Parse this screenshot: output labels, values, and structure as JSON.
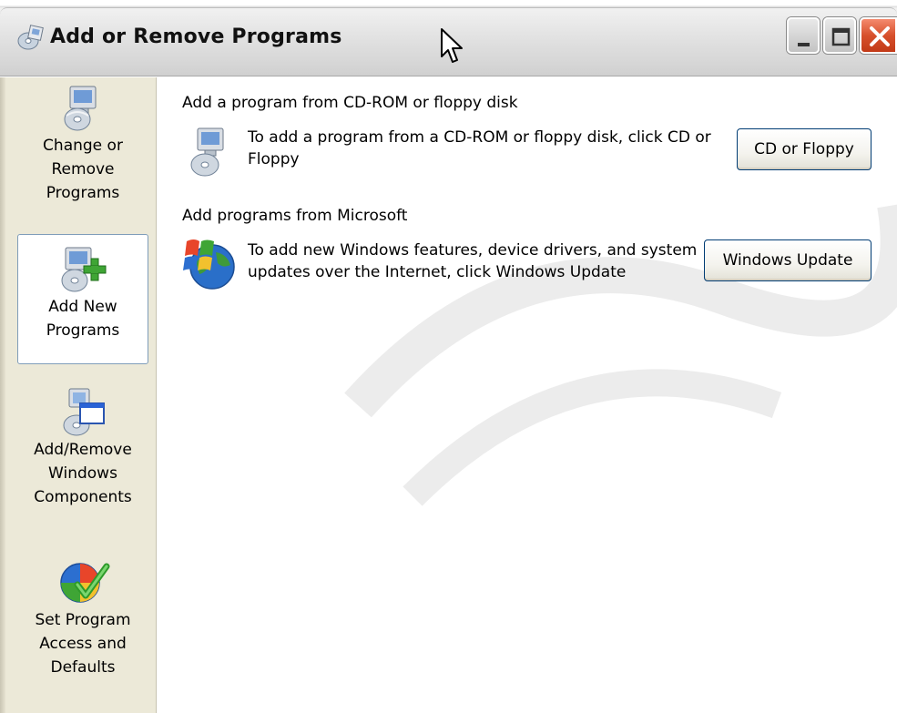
{
  "window": {
    "title": "Add or Remove Programs",
    "title_bar_buttons": {
      "minimize_icon": "minimize-icon",
      "maximize_icon": "maximize-icon",
      "close_icon": "close-icon"
    }
  },
  "sidebar": {
    "items": [
      {
        "label": "Change or\nRemove\nPrograms",
        "icon": "change-remove-programs-icon",
        "selected": false
      },
      {
        "label": "Add New\nPrograms",
        "icon": "add-new-programs-icon",
        "selected": true
      },
      {
        "label": "Add/Remove\nWindows\nComponents",
        "icon": "windows-components-icon",
        "selected": false
      },
      {
        "label": "Set Program\nAccess and\nDefaults",
        "icon": "program-access-defaults-icon",
        "selected": false
      }
    ]
  },
  "main": {
    "sections": [
      {
        "heading": "Add a program from CD-ROM or floppy disk",
        "description": "To add a program from a CD-ROM or floppy disk, click CD or Floppy",
        "button_label": "CD or Floppy",
        "icon": "cd-floppy-install-icon"
      },
      {
        "heading": "Add programs from Microsoft",
        "description": "To add new Windows features, device drivers, and system updates over the Internet, click Windows Update",
        "button_label": "Windows Update",
        "icon": "windows-update-globe-icon"
      }
    ]
  },
  "colors": {
    "sidebar_bg": "#ece9d8",
    "selected_border": "#7f9db9",
    "button_border": "#003c74",
    "close_button": "#d7502c"
  }
}
